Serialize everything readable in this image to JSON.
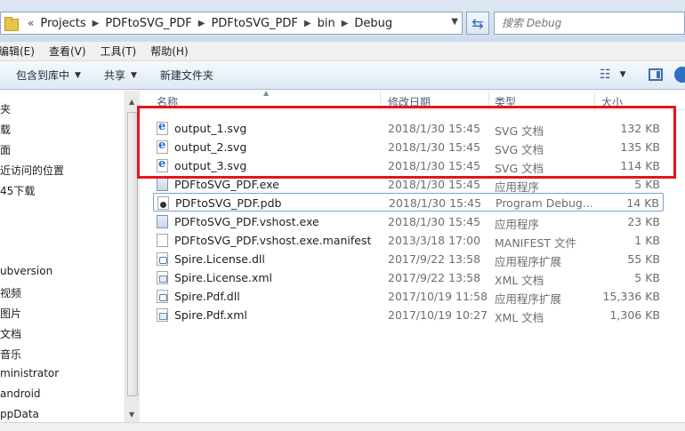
{
  "address_bar": {
    "overflow": "«",
    "crumbs": [
      "Projects",
      "PDFtoSVG_PDF",
      "PDFtoSVG_PDF",
      "bin",
      "Debug"
    ],
    "search_placeholder": "搜索 Debug"
  },
  "menu": [
    "编辑(E)",
    "查看(V)",
    "工具(T)",
    "帮助(H)"
  ],
  "toolbar": {
    "include_in_library": "包含到库中",
    "share": "共享",
    "new_folder": "新建文件夹"
  },
  "nav": [
    "夹",
    "载",
    "面",
    "近访问的位置",
    "45下载",
    "ubversion",
    "视频",
    "图片",
    "文档",
    "音乐",
    "ministrator",
    "android",
    "ppData"
  ],
  "columns": {
    "name": "名称",
    "date": "修改日期",
    "type": "类型",
    "size": "大小"
  },
  "files": [
    {
      "name": "output_1.svg",
      "date": "2018/1/30 15:45",
      "type": "SVG 文档",
      "size": "132 KB",
      "icon": "ie-document-icon"
    },
    {
      "name": "output_2.svg",
      "date": "2018/1/30 15:45",
      "type": "SVG 文档",
      "size": "135 KB",
      "icon": "ie-document-icon"
    },
    {
      "name": "output_3.svg",
      "date": "2018/1/30 15:45",
      "type": "SVG 文档",
      "size": "114 KB",
      "icon": "ie-document-icon"
    },
    {
      "name": "PDFtoSVG_PDF.exe",
      "date": "2018/1/30 15:45",
      "type": "应用程序",
      "size": "5 KB",
      "icon": "application-icon"
    },
    {
      "name": "PDFtoSVG_PDF.pdb",
      "date": "2018/1/30 15:45",
      "type": "Program Debug...",
      "size": "14 KB",
      "icon": "pdb-file-icon"
    },
    {
      "name": "PDFtoSVG_PDF.vshost.exe",
      "date": "2018/1/30 15:45",
      "type": "应用程序",
      "size": "23 KB",
      "icon": "application-icon"
    },
    {
      "name": "PDFtoSVG_PDF.vshost.exe.manifest",
      "date": "2013/3/18 17:00",
      "type": "MANIFEST 文件",
      "size": "1 KB",
      "icon": "blank-file-icon"
    },
    {
      "name": "Spire.License.dll",
      "date": "2017/9/22 13:58",
      "type": "应用程序扩展",
      "size": "55 KB",
      "icon": "dll-file-icon"
    },
    {
      "name": "Spire.License.xml",
      "date": "2017/9/22 13:58",
      "type": "XML 文档",
      "size": "5 KB",
      "icon": "xml-file-icon"
    },
    {
      "name": "Spire.Pdf.dll",
      "date": "2017/10/19 11:58",
      "type": "应用程序扩展",
      "size": "15,336 KB",
      "icon": "dll-file-icon"
    },
    {
      "name": "Spire.Pdf.xml",
      "date": "2017/10/19 10:27",
      "type": "XML 文档",
      "size": "1,306 KB",
      "icon": "xml-file-icon"
    }
  ],
  "colors": {
    "highlight": "#e5141a",
    "selection_border": "#7da2ce",
    "header_text": "#4c607a"
  }
}
